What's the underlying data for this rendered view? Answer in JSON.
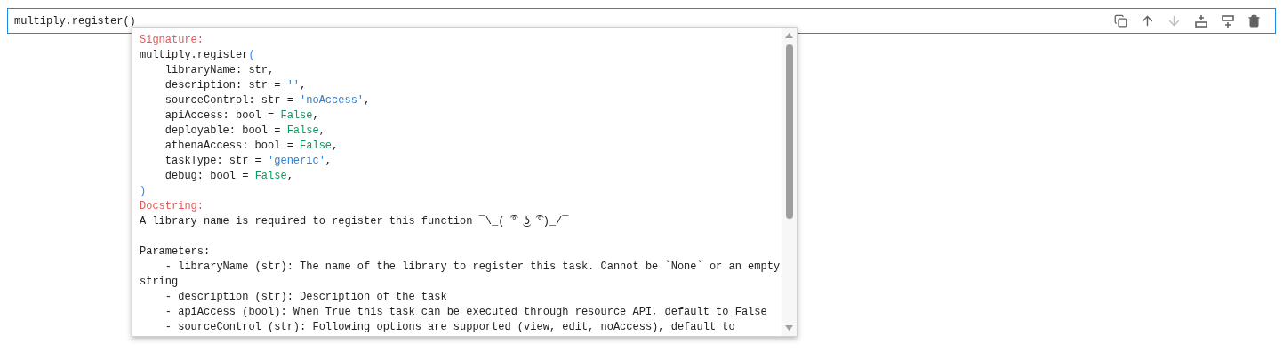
{
  "cell": {
    "code": "multiply.register()"
  },
  "toolbar": [
    {
      "kind": "duplicate",
      "disabled": false
    },
    {
      "kind": "up",
      "disabled": false
    },
    {
      "kind": "down",
      "disabled": true
    },
    {
      "kind": "insert-above",
      "disabled": false
    },
    {
      "kind": "insert-below",
      "disabled": false
    },
    {
      "kind": "delete",
      "disabled": false
    }
  ],
  "tooltip": {
    "signature_heading": "Signature:",
    "signature_lines": [
      [
        {
          "kind": "plain",
          "text": "multiply.register"
        },
        {
          "kind": "paren",
          "text": "("
        }
      ],
      [
        {
          "kind": "plain",
          "text": "    libraryName: str,"
        }
      ],
      [
        {
          "kind": "plain",
          "text": "    description: str = "
        },
        {
          "kind": "string",
          "text": "''"
        },
        {
          "kind": "plain",
          "text": ","
        }
      ],
      [
        {
          "kind": "plain",
          "text": "    sourceControl: str = "
        },
        {
          "kind": "string",
          "text": "'noAccess'"
        },
        {
          "kind": "plain",
          "text": ","
        }
      ],
      [
        {
          "kind": "plain",
          "text": "    apiAccess: bool = "
        },
        {
          "kind": "keyword",
          "text": "False"
        },
        {
          "kind": "plain",
          "text": ","
        }
      ],
      [
        {
          "kind": "plain",
          "text": "    deployable: bool = "
        },
        {
          "kind": "keyword",
          "text": "False"
        },
        {
          "kind": "plain",
          "text": ","
        }
      ],
      [
        {
          "kind": "plain",
          "text": "    athenaAccess: bool = "
        },
        {
          "kind": "keyword",
          "text": "False"
        },
        {
          "kind": "plain",
          "text": ","
        }
      ],
      [
        {
          "kind": "plain",
          "text": "    taskType: str = "
        },
        {
          "kind": "string",
          "text": "'generic'"
        },
        {
          "kind": "plain",
          "text": ","
        }
      ],
      [
        {
          "kind": "plain",
          "text": "    debug: bool = "
        },
        {
          "kind": "keyword",
          "text": "False"
        },
        {
          "kind": "plain",
          "text": ","
        }
      ],
      [
        {
          "kind": "paren",
          "text": ")"
        }
      ]
    ],
    "docstring_heading": "Docstring:",
    "docstring_lines": [
      "A library name is required to register this function ¯\\_( ͡° ͜ʖ ͡°)_/¯"
    ],
    "parameters_heading": "Parameters:",
    "parameter_lines": [
      "    - libraryName (str): The name of the library to register this task. Cannot be `None` or an empty",
      "string",
      "    - description (str): Description of the task",
      "    - apiAccess (bool): When True this task can be executed through resource API, default to False",
      "    - sourceControl (str): Following options are supported (view, edit, noAccess), default to"
    ]
  }
}
